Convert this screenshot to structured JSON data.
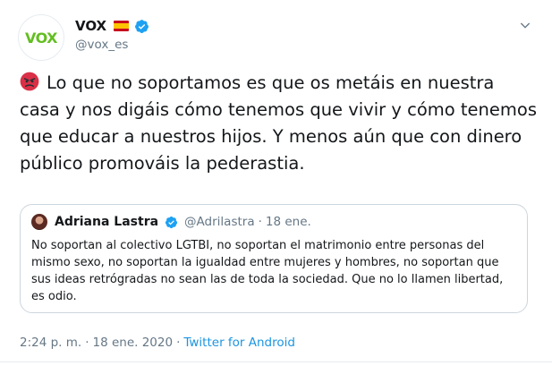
{
  "author": {
    "display_name": "VOX",
    "handle": "@vox_es",
    "avatar_text": "VOX",
    "flag_icon": "spain-flag-icon",
    "verified_icon": "verified-badge-icon"
  },
  "tweet": {
    "emoji_icon": "angry-face-emoji",
    "text": "Lo que no soportamos es que os metáis en nuestra casa y nos digáis cómo tenemos que vivir y cómo tenemos que educar a nuestros hijos. Y menos aún que con dinero público promováis la pederastia."
  },
  "quoted_tweet": {
    "display_name": "Adriana Lastra",
    "handle": "@Adrilastra",
    "separator": "·",
    "date": "18 ene.",
    "text": "No soportan al colectivo LGTBI, no soportan el matrimonio entre personas del mismo sexo, no soportan la igualdad entre mujeres y hombres, no soportan que sus ideas retrógradas no sean las de toda la sociedad. Que no lo llamen libertad, es odio."
  },
  "footer": {
    "time": "2:24 p. m.",
    "separator": "·",
    "date": "18 ene. 2020",
    "separator2": "·",
    "source": "Twitter for Android"
  },
  "colors": {
    "verified_blue": "#1da1f2",
    "link_blue": "#1b95e0",
    "vox_green": "#63be21",
    "muted_gray": "#657786"
  }
}
